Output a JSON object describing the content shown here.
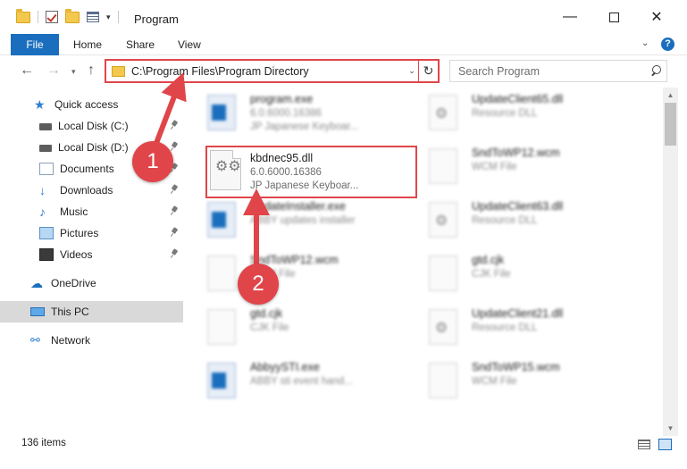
{
  "window": {
    "title": "Program",
    "minimize_glyph": "—",
    "close_glyph": "✕"
  },
  "ribbon": {
    "tabs": [
      "File",
      "Home",
      "Share",
      "View"
    ],
    "help_glyph": "?",
    "collapse_glyph": "⌄"
  },
  "nav": {
    "back_glyph": "←",
    "forward_glyph": "→",
    "recent_glyph": "▾",
    "up_glyph": "↑",
    "address": "C:\\Program Files\\Program Directory",
    "address_dropdown_glyph": "⌄",
    "refresh_glyph": "↻",
    "search_placeholder": "Search Program"
  },
  "sidebar": {
    "items": [
      {
        "label": "Quick access",
        "icon": "star-icon",
        "glyph": "★"
      },
      {
        "label": "Local Disk (C:)",
        "icon": "drive-icon",
        "pinned": true
      },
      {
        "label": "Local Disk (D:)",
        "icon": "drive-icon",
        "pinned": true
      },
      {
        "label": "Documents",
        "icon": "documents-icon",
        "pinned": true
      },
      {
        "label": "Downloads",
        "icon": "download-icon",
        "glyph": "↓",
        "pinned": true
      },
      {
        "label": "Music",
        "icon": "music-icon",
        "glyph": "♪",
        "pinned": true
      },
      {
        "label": "Pictures",
        "icon": "pictures-icon",
        "pinned": true
      },
      {
        "label": "Videos",
        "icon": "video-icon",
        "pinned": true
      },
      {
        "label": "OneDrive",
        "icon": "cloud-icon",
        "glyph": "☁"
      },
      {
        "label": "This PC",
        "icon": "computer-icon",
        "selected": true
      },
      {
        "label": "Network",
        "icon": "network-icon",
        "glyph": "⚯"
      }
    ]
  },
  "files": {
    "highlighted": {
      "name": "kbdnec95.dll",
      "version": "6.0.6000.16386",
      "description": "JP Japanese Keyboar...",
      "icon_glyph": "⚙⚙"
    },
    "left_column": [
      {
        "name": "program.exe",
        "line1": "6.0.6000.16386",
        "line2": "JP Japanese Keyboar...",
        "icon": "exe"
      },
      {
        "name": "",
        "line1": "",
        "line2": "",
        "icon": "gear"
      },
      {
        "name": "UpdateInstaller.exe",
        "line1": "ABBY updates installer",
        "line2": "",
        "icon": "exe"
      },
      {
        "name": "SndToWP12.wcm",
        "line1": "WCM File",
        "line2": "",
        "icon": "blank"
      },
      {
        "name": "gtd.cjk",
        "line1": "CJK File",
        "line2": "",
        "icon": "blank"
      },
      {
        "name": "AbbyySTI.exe",
        "line1": "ABBY sti event hand...",
        "line2": "",
        "icon": "exe"
      }
    ],
    "right_column": [
      {
        "name": "UpdateClient65.dll",
        "line1": "Resource DLL",
        "icon": "gear"
      },
      {
        "name": "SndToWP12.wcm",
        "line1": "WCM File",
        "icon": "blank"
      },
      {
        "name": "UpdateClient63.dll",
        "line1": "Resource DLL",
        "icon": "gear"
      },
      {
        "name": "gtd.cjk",
        "line1": "CJK File",
        "icon": "blank"
      },
      {
        "name": "UpdateClient21.dll",
        "line1": "Resource DLL",
        "icon": "gear"
      },
      {
        "name": "SndToWP15.wcm",
        "line1": "WCM File",
        "icon": "blank"
      }
    ]
  },
  "status": {
    "item_count": "136 items"
  },
  "annotations": {
    "step1": "1",
    "step2": "2",
    "color": "#e0454a"
  },
  "colors": {
    "accent": "#1a6ebd",
    "highlight": "#e0454a",
    "selected_nav": "#d9d9d9"
  }
}
